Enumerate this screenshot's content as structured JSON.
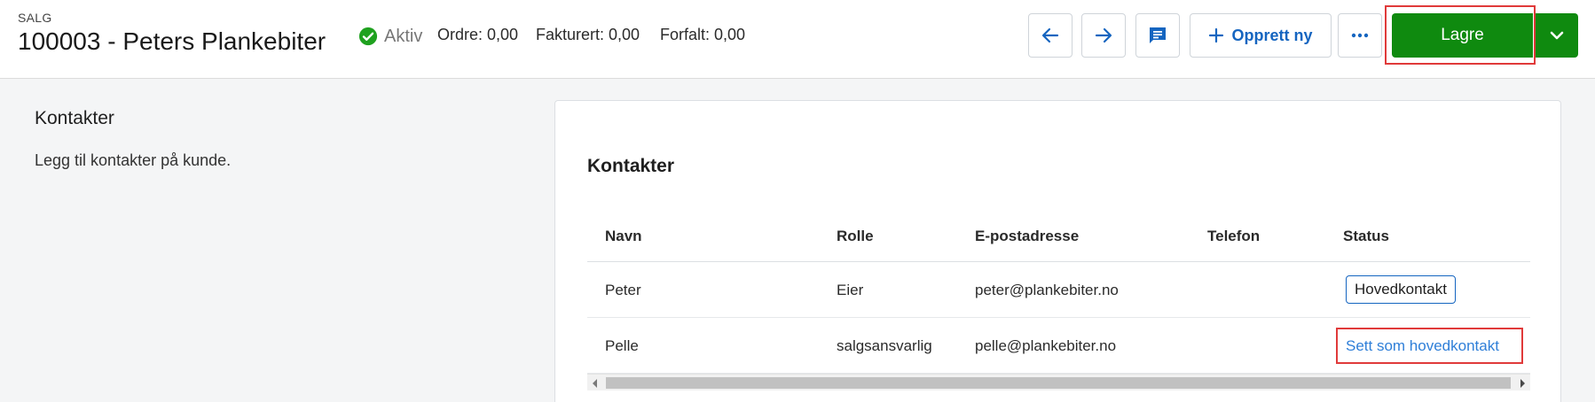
{
  "header": {
    "module": "SALG",
    "title": "100003 - Peters Plankebiter",
    "status": "Aktiv",
    "metrics": [
      {
        "label": "Ordre: 0,00"
      },
      {
        "label": "Fakturert: 0,00"
      },
      {
        "label": "Forfalt: 0,00"
      }
    ],
    "create_label": "Opprett ny",
    "save_label": "Lagre"
  },
  "icons": {
    "status": "check-circle-icon",
    "back": "arrow-left-icon",
    "forward": "arrow-right-icon",
    "comments": "comment-icon",
    "create": "plus-icon",
    "more": "more-horizontal-icon",
    "save_menu": "chevron-down-icon"
  },
  "colors": {
    "primary_green": "#0f8a0f",
    "accent_blue": "#1565c0",
    "link_blue": "#2f7fd8",
    "status_green": "#1fa11f",
    "highlight_red": "#e03a3a"
  },
  "section": {
    "title": "Kontakter",
    "description": "Legg til kontakter på kunde."
  },
  "contacts": {
    "title": "Kontakter",
    "columns": [
      "Navn",
      "Rolle",
      "E-postadresse",
      "Telefon",
      "Status"
    ],
    "rows": [
      {
        "name": "Peter",
        "role": "Eier",
        "email": "peter@plankebiter.no",
        "phone": "",
        "status": "Hovedkontakt"
      },
      {
        "name": "Pelle",
        "role": "salgsansvarlig",
        "email": "pelle@plankebiter.no",
        "phone": "",
        "status": "Sett som hovedkontakt"
      }
    ]
  }
}
